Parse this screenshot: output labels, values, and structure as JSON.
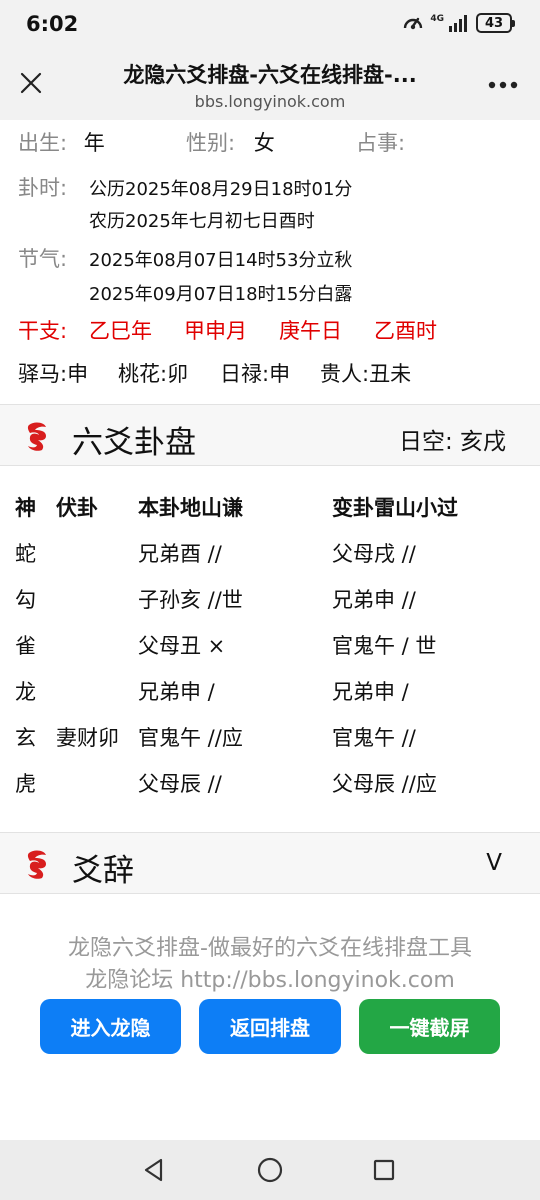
{
  "status_bar": {
    "time": "6:02",
    "network": "4G",
    "battery": "43"
  },
  "browser": {
    "title": "龙隐六爻排盘-六爻在线排盘-...",
    "url": "bbs.longyinok.com",
    "close_icon": "close-icon",
    "menu_icon": "more-icon"
  },
  "info": {
    "birth_label": "出生:",
    "birth_value": "年",
    "gender_label": "性别:",
    "gender_value": "女",
    "matter_label": "占事:",
    "matter_value": "",
    "gua_time_label": "卦时:",
    "gua_time_solar": "公历2025年08月29日18时01分",
    "gua_time_lunar": "农历2025年七月初七日酉时",
    "solar_term_label": "节气:",
    "solar_term_1": "2025年08月07日14时53分立秋",
    "solar_term_2": "2025年09月07日18时15分白露",
    "ganzhi_label": "干支:",
    "ganzhi": [
      "乙巳年",
      "甲申月",
      "庚午日",
      "乙酉时"
    ],
    "shensha": [
      "驿马:申",
      "桃花:卯",
      "日禄:申",
      "贵人:丑未"
    ]
  },
  "section1": {
    "title": "六爻卦盘",
    "right": "日空:  亥戌",
    "icon": "dragon-logo-icon"
  },
  "table": {
    "headers": [
      "神",
      "伏卦",
      "本卦地山谦",
      "变卦雷山小过"
    ],
    "rows": [
      {
        "shen": "蛇",
        "fu": "",
        "ben": "兄弟酉 //",
        "bian": "父母戌 //"
      },
      {
        "shen": "勾",
        "fu": "",
        "ben": "子孙亥 //世",
        "bian": "兄弟申 //"
      },
      {
        "shen": "雀",
        "fu": "",
        "ben": "父母丑 ×",
        "bian": "官鬼午  / 世"
      },
      {
        "shen": "龙",
        "fu": "",
        "ben": "兄弟申  /",
        "bian": "兄弟申  /"
      },
      {
        "shen": "玄",
        "fu": "妻财卯",
        "ben": "官鬼午 //应",
        "bian": "官鬼午 //"
      },
      {
        "shen": "虎",
        "fu": "",
        "ben": "父母辰 //",
        "bian": "父母辰 //应"
      }
    ]
  },
  "section2": {
    "title": "爻辞",
    "toggle": "V",
    "icon": "dragon-logo-icon"
  },
  "footer": {
    "line1": "龙隐六爻排盘-做最好的六爻在线排盘工具",
    "line2": "龙隐论坛 http://bbs.longyinok.com",
    "btn_enter": "进入龙隐",
    "btn_back": "返回排盘",
    "btn_screenshot": "一键截屏"
  },
  "colors": {
    "accent_blue": "#0d7ef6",
    "accent_green": "#23a745",
    "ganzhi_red": "#e00000",
    "logo_red": "#d81e1e"
  }
}
